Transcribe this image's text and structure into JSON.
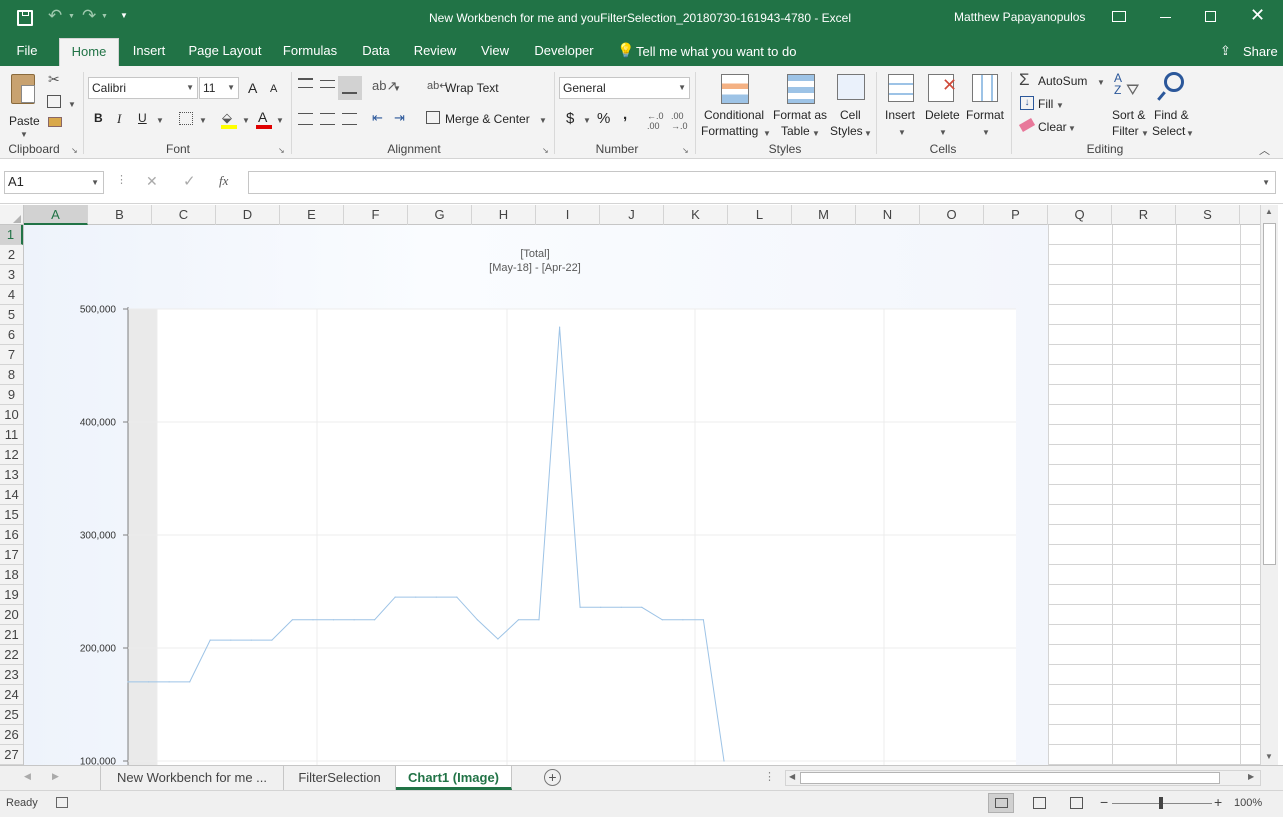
{
  "window": {
    "title": "New Workbench for me and youFilterSelection_20180730-161943-4780  -  Excel",
    "user": "Matthew Papayanopulos"
  },
  "ribbon_tabs": [
    "File",
    "Home",
    "Insert",
    "Page Layout",
    "Formulas",
    "Data",
    "Review",
    "View",
    "Developer"
  ],
  "tell_me": "Tell me what you want to do",
  "share": "Share",
  "ribbon": {
    "clipboard": {
      "paste": "Paste",
      "label": "Clipboard"
    },
    "font": {
      "name": "Calibri",
      "size": "11",
      "bold": "B",
      "italic": "I",
      "underline": "U",
      "grow": "A",
      "shrink": "A",
      "color_letter": "A",
      "label": "Font"
    },
    "alignment": {
      "wrap": "Wrap Text",
      "merge": "Merge & Center",
      "label": "Alignment"
    },
    "number": {
      "format": "General",
      "currency": "$",
      "percent": "%",
      "comma": ",",
      "label": "Number"
    },
    "styles": {
      "conditional_1": "Conditional",
      "conditional_2": "Formatting",
      "format_table_1": "Format as",
      "format_table_2": "Table",
      "cell_styles_1": "Cell",
      "cell_styles_2": "Styles",
      "label": "Styles"
    },
    "cells": {
      "insert": "Insert",
      "delete": "Delete",
      "format": "Format",
      "label": "Cells"
    },
    "editing": {
      "autosum": "AutoSum",
      "fill": "Fill",
      "clear": "Clear",
      "sort_1": "Sort &",
      "sort_2": "Filter",
      "find_1": "Find &",
      "find_2": "Select",
      "label": "Editing"
    }
  },
  "name_box": "A1",
  "formula_value": "",
  "columns": [
    "A",
    "B",
    "C",
    "D",
    "E",
    "F",
    "G",
    "H",
    "I",
    "J",
    "K",
    "L",
    "M",
    "N",
    "O",
    "P",
    "Q",
    "R",
    "S"
  ],
  "rows": [
    "1",
    "2",
    "3",
    "4",
    "5",
    "6",
    "7",
    "8",
    "9",
    "10",
    "11",
    "12",
    "13",
    "14",
    "15",
    "16",
    "17",
    "18",
    "19",
    "20",
    "21",
    "22",
    "23",
    "24",
    "25",
    "26",
    "27"
  ],
  "chart_data": {
    "type": "line",
    "title": "[Total]",
    "subtitle": "[May-18] - [Apr-22]",
    "yticks": [
      "500,000",
      "400,000",
      "300,000",
      "200,000",
      "100,000"
    ],
    "ylim": [
      100000,
      500000
    ],
    "grid": true,
    "legend": "none",
    "series_color": "#9dc3e6",
    "series": [
      {
        "values": [
          170000,
          170000,
          170000,
          170000,
          207000,
          207000,
          207000,
          207000,
          225000,
          225000,
          225000,
          225000,
          225000,
          245000,
          245000,
          245000,
          245000,
          225000,
          208000,
          225000,
          225000,
          484000,
          236000,
          236000,
          236000,
          236000,
          225000,
          225000,
          225000,
          100000
        ]
      }
    ]
  },
  "sheet_tabs": [
    "New Workbench for me ...",
    "FilterSelection",
    "Chart1 (Image)"
  ],
  "status": {
    "ready": "Ready",
    "zoom": "100%"
  }
}
